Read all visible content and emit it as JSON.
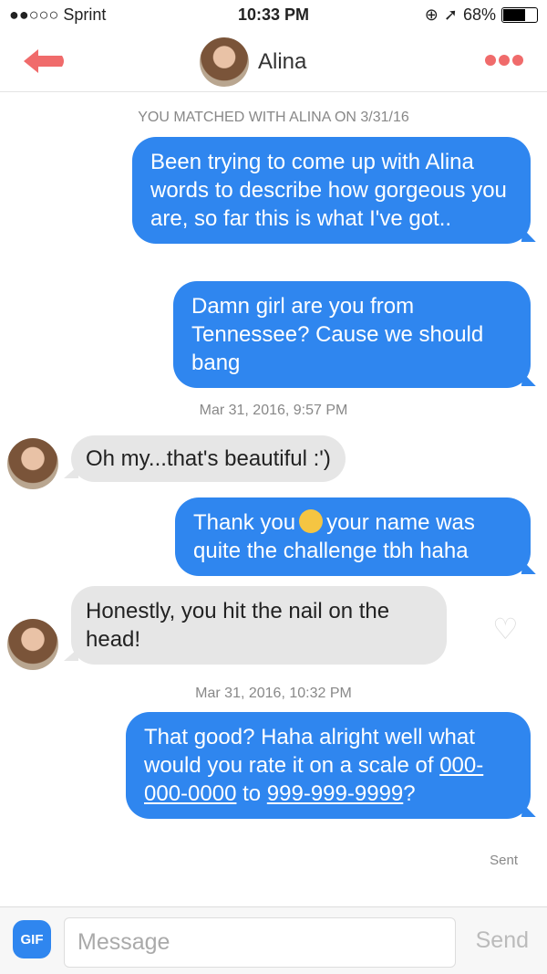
{
  "status": {
    "carrier": "●●○○○ Sprint",
    "time": "10:33 PM",
    "battery": "68%",
    "battery_level": 0.68
  },
  "header": {
    "name": "Alina",
    "back_icon": "arrow-left-icon",
    "more_icon": "more-dots-icon"
  },
  "matched": "YOU MATCHED WITH ALINA ON 3/31/16",
  "messages": [
    {
      "from": "me",
      "text": "Been trying to come up with Alina words to describe how gorgeous you are, so far this is what I've got.."
    },
    {
      "from": "me",
      "text": "Damn girl are you from Tennessee? Cause we should bang"
    },
    {
      "timestamp": "Mar 31, 2016, 9:57 PM"
    },
    {
      "from": "Alina",
      "text": "Oh my...that's beautiful :')"
    },
    {
      "from": "me",
      "text_before": "Thank you",
      "text_after": "your name was quite the challenge tbh haha",
      "emoji": "relieved-face"
    },
    {
      "from": "Alina",
      "text": "Honestly, you hit the nail on the head!"
    },
    {
      "timestamp": "Mar 31, 2016, 10:32 PM"
    },
    {
      "from": "me",
      "text": "That good? Haha alright well what would you rate it on a scale of",
      "link1": "000-000-0000",
      "mid": "to",
      "link2": "999-999-9999",
      "end": "?"
    }
  ],
  "sent_label": "Sent",
  "composer": {
    "gif": "GIF",
    "placeholder": "Message",
    "send": "Send"
  },
  "colors": {
    "accent": "#2f86ef",
    "tinder": "#f06b6b",
    "received": "#e6e6e6"
  }
}
